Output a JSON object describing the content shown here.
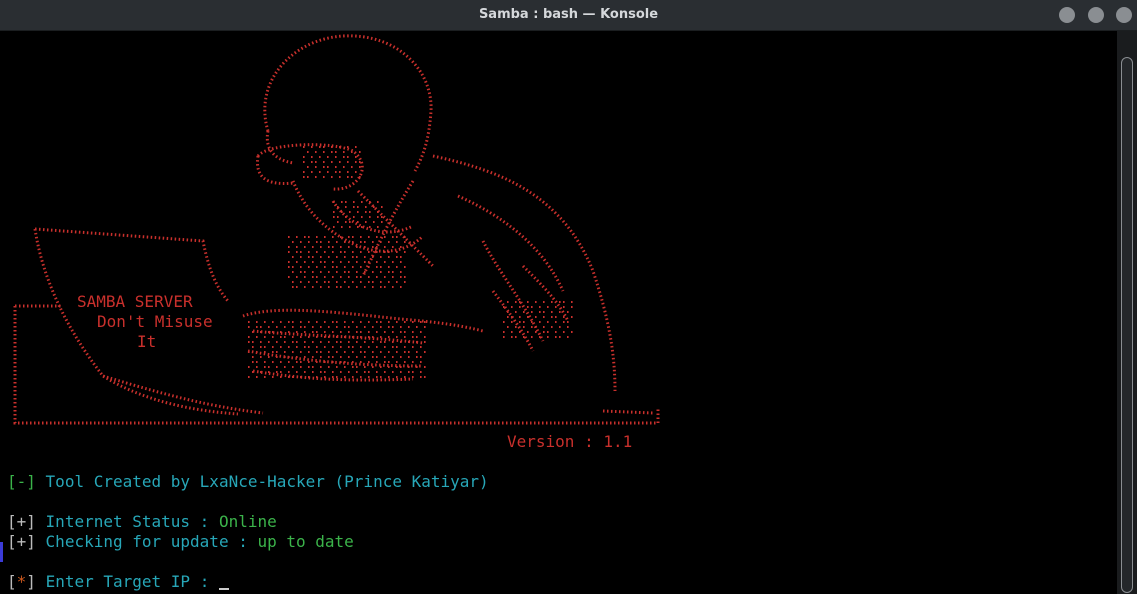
{
  "window": {
    "title": "Samba : bash — Konsole",
    "buttons": [
      "minimize-icon",
      "maximize-icon",
      "close-icon"
    ]
  },
  "colors": {
    "art": "#c9302c",
    "cyan": "#27a7b8",
    "green": "#3bb34a",
    "orange": "#d05a1e"
  },
  "banner": {
    "line1": "SAMBA SERVER",
    "line2": "Don't Misuse",
    "line3": "It",
    "version": "Version : 1.1"
  },
  "console": {
    "credit_prefix": "[-]",
    "credit_text": "Tool Created by LxaNce-Hacker (Prince Katiyar)",
    "internet_prefix": "[+]",
    "internet_label": "Internet Status :",
    "internet_value": "Online",
    "update_prefix": "[+]",
    "update_label": "Checking for update :",
    "update_value": "up to date",
    "prompt_open": "[",
    "prompt_star": "*",
    "prompt_close": "]",
    "prompt_label": "Enter Target IP :"
  }
}
